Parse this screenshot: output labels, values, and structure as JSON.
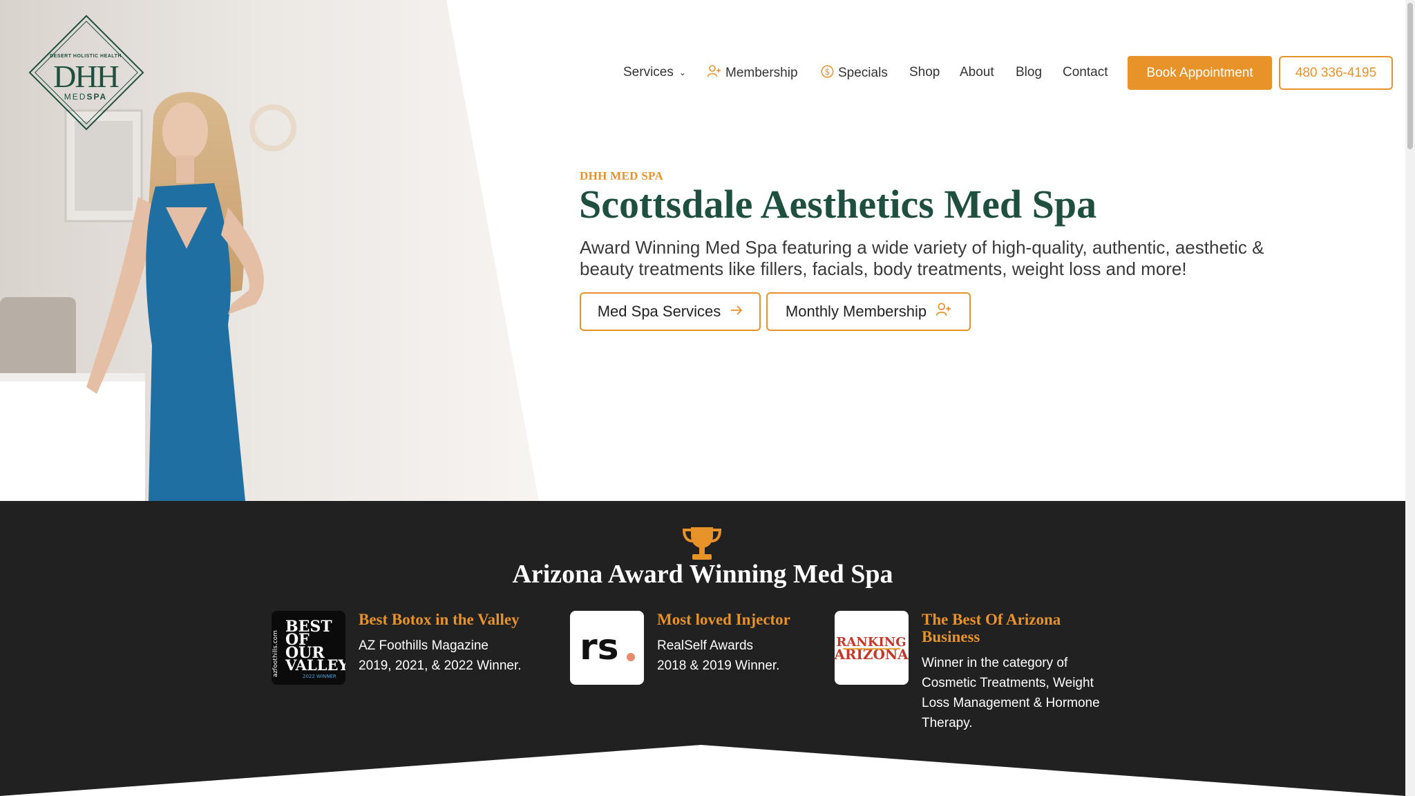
{
  "logo": {
    "top_text": "DESERT HOLISTIC HEALTH",
    "main_text": "DHH",
    "sub_text_1": "MED",
    "sub_text_2": "SPA"
  },
  "nav": {
    "items": [
      {
        "label": "Services",
        "icon": "chevron-down-icon"
      },
      {
        "label": "Membership",
        "icon": "user-plus-icon"
      },
      {
        "label": "Specials",
        "icon": "dollar-circle-icon"
      },
      {
        "label": "Shop"
      },
      {
        "label": "About"
      },
      {
        "label": "Blog"
      },
      {
        "label": "Contact"
      }
    ],
    "book_label": "Book Appointment",
    "phone_label": "480 336-4195"
  },
  "hero": {
    "eyebrow": "DHH MED SPA",
    "title": "Scottsdale Aesthetics Med Spa",
    "subtitle": "Award Winning Med Spa featuring a wide variety of high-quality, authentic, aesthetic & beauty treatments like fillers, facials, body treatments, weight loss and more!",
    "cta_services": "Med Spa Services",
    "cta_membership": "Monthly Membership"
  },
  "awards": {
    "title": "Arizona Award Winning Med Spa",
    "items": [
      {
        "title": "Best Botox in the Valley",
        "lines": [
          "AZ Foothills Magazine",
          "2019, 2021, & 2022 Winner."
        ],
        "badge": {
          "line1": "BEST",
          "line2": "OF",
          "line3": "OUR",
          "line4": "VALLEY",
          "side": "azfoothills.com",
          "foot": "2022 WINNER"
        }
      },
      {
        "title": "Most loved Injector",
        "lines": [
          "RealSelf Awards",
          "2018 & 2019 Winner."
        ],
        "badge": {
          "text": "rs"
        }
      },
      {
        "title_line1": "The Best Of Arizona",
        "title_line2": "Business",
        "lines": [
          "Winner in the category of",
          "Cosmetic Treatments, Weight",
          "Loss Management & Hormone",
          "Therapy."
        ],
        "badge": {
          "line1": "RANKING",
          "line2": "ARIZONA"
        }
      }
    ]
  },
  "colors": {
    "accent": "#e8922a",
    "brand_green": "#1f4f3f",
    "dark_band": "#212121"
  }
}
